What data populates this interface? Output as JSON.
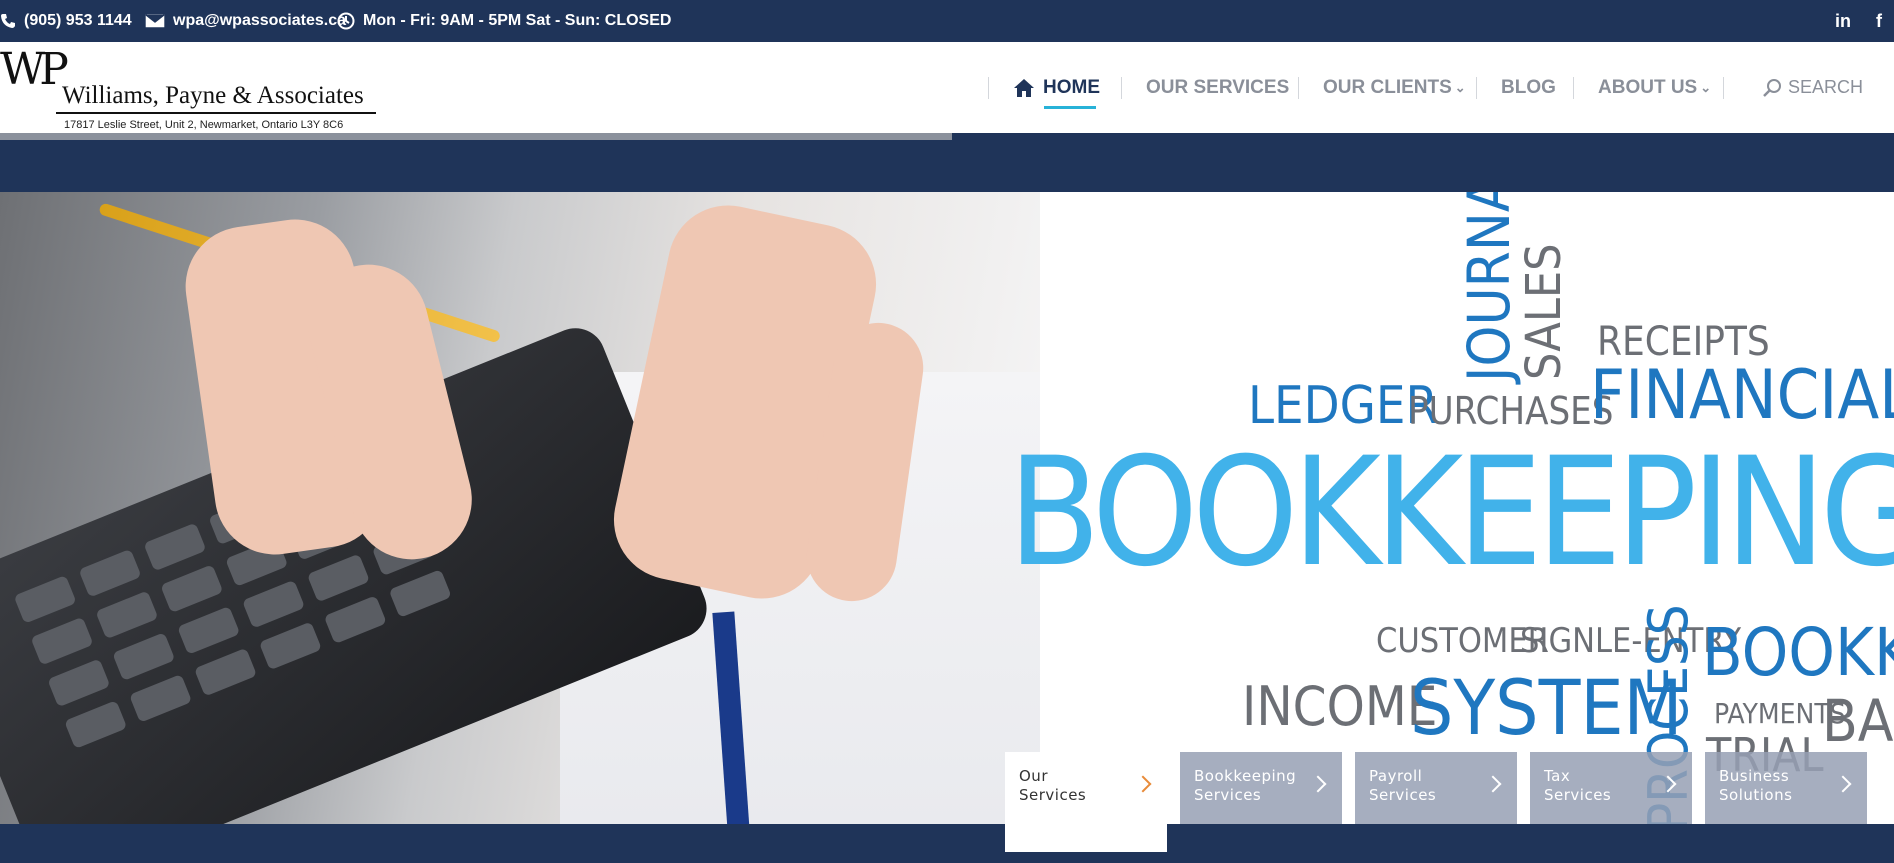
{
  "topbar": {
    "phone": "(905) 953 1144",
    "email": "wpa@wpassociates.ca",
    "hours": "Mon - Fri: 9AM - 5PM Sat - Sun: CLOSED",
    "social": [
      {
        "icon": "linkedin-icon",
        "label": "in"
      },
      {
        "icon": "facebook-icon",
        "label": "f"
      }
    ]
  },
  "logo": {
    "mark": "WP",
    "name": "Williams, Payne & Associates",
    "address": "17817 Leslie Street, Unit 2, Newmarket, Ontario  L3Y 8C6"
  },
  "nav": {
    "items": [
      {
        "label": "HOME",
        "active": true
      },
      {
        "label": "OUR SERVICES"
      },
      {
        "label": "OUR CLIENTS"
      },
      {
        "label": "BLOG"
      },
      {
        "label": "ABOUT US"
      }
    ],
    "search_label": "SEARCH"
  },
  "hero": {
    "words": {
      "journals": "JOURNALS",
      "sales": "SALES",
      "receipts": "RECEIPTS",
      "ledger": "LEDGER",
      "purchases": "PURCHASES",
      "financial": "FINANCIAL",
      "bookkeeping": "BOOKKEEPING",
      "customer": "CUSTOMER",
      "single_entry": "SIGNLE-ENTRY",
      "bookkeeping_small": "BOOKKE",
      "income": "INCOME",
      "system": "SYSTEM",
      "process": "PROCESS",
      "payments": "PAYMENTS",
      "trial": "TRIAL",
      "bal": "BAL"
    }
  },
  "services": [
    {
      "line1": "Our",
      "line2": "Services"
    },
    {
      "line1": "Bookkeeping",
      "line2": "Services"
    },
    {
      "line1": "Payroll",
      "line2": "Services"
    },
    {
      "line1": "Tax",
      "line2": "Services"
    },
    {
      "line1": "Business",
      "line2": "Solutions"
    }
  ],
  "colors": {
    "navy": "#1f3459",
    "accent_underline": "#28b2d8",
    "cloud_blue": "#1f77c0",
    "cloud_light_blue": "#41b2ea",
    "card_chevron_orange": "#e88b3a"
  }
}
